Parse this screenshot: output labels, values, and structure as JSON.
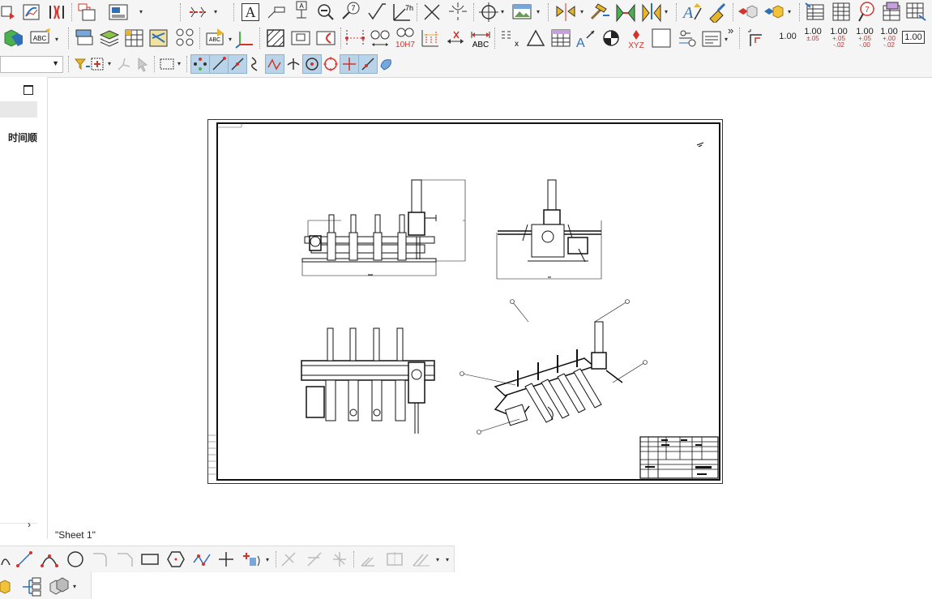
{
  "toolbar_row1": {
    "text_tool_glyph": "A",
    "dimension_label": "7h"
  },
  "toolbar_row2": {
    "fit_label": "10H7",
    "abc_label": "ABC",
    "xyz_label": "XYZ",
    "more_glyph": "»",
    "tolerances": [
      {
        "main": "1.00",
        "sub": ""
      },
      {
        "main": "1.00",
        "sub": "±.05"
      },
      {
        "main": "1.00",
        "sub": "+.05 -.02"
      },
      {
        "main": "1.00",
        "sub": "+.05 -.00"
      },
      {
        "main": "1.00",
        "sub": "+.00 -.02"
      },
      {
        "main": "1.00",
        "sub": ""
      }
    ]
  },
  "left_panel": {
    "column_header": "时间顺",
    "scroll_right_glyph": "›"
  },
  "canvas": {
    "sheet_label": "\"Sheet 1\""
  },
  "colors": {
    "toolbar_bg": "#f5f5f5",
    "pressed": "#b9d3e8",
    "accent_red": "#d0342c",
    "accent_blue": "#2f6fb5"
  }
}
